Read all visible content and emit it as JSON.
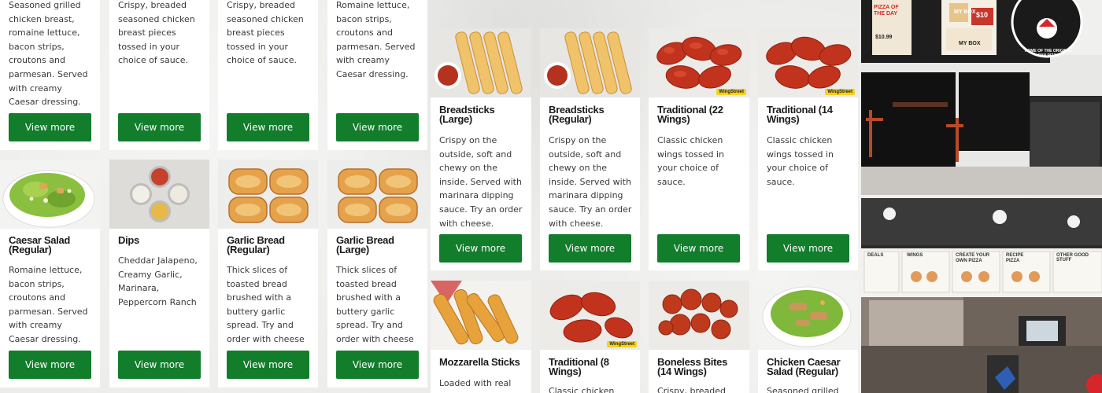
{
  "cards": [
    {
      "id": "chicken-caesar-top",
      "title": "",
      "desc": "Seasoned grilled chicken breast, romaine lettuce, bacon strips, croutons and parmesan. Served with creamy Caesar dressing.",
      "button": "View more"
    },
    {
      "id": "boneless-a-top",
      "title": "",
      "desc": "Crispy, breaded seasoned chicken breast pieces tossed in your choice of sauce.",
      "button": "View more"
    },
    {
      "id": "boneless-b-top",
      "title": "",
      "desc": "Crispy, breaded seasoned chicken breast pieces tossed in your choice of sauce.",
      "button": "View more"
    },
    {
      "id": "caesar-large-top",
      "title": "",
      "desc": "Romaine lettuce, bacon strips, croutons and parmesan. Served with creamy Caesar dressing.",
      "button": "View more"
    },
    {
      "id": "caesar-regular",
      "title": "Caesar Salad (Regular)",
      "desc": "Romaine lettuce, bacon strips, croutons and parmesan. Served with creamy Caesar dressing.",
      "button": "View more"
    },
    {
      "id": "dips",
      "title": "Dips",
      "desc": "Cheddar Jalapeno, Creamy Garlic, Marinara, Peppercorn Ranch",
      "button": "View more"
    },
    {
      "id": "garlic-bread-regular",
      "title": "Garlic Bread (Regular)",
      "desc": "Thick slices of toasted bread brushed with a buttery garlic spread. Try and order with cheese",
      "button": "View more"
    },
    {
      "id": "garlic-bread-large",
      "title": "Garlic Bread (Large)",
      "desc": "Thick slices of toasted bread brushed with a buttery garlic spread. Try and order with cheese",
      "button": "View more"
    },
    {
      "id": "breadsticks-large",
      "title": "Breadsticks (Large)",
      "desc": "Crispy on the outside, soft and chewy on the inside. Served with marinara dipping sauce. Try an order with cheese.",
      "button": "View more"
    },
    {
      "id": "breadsticks-regular",
      "title": "Breadsticks (Regular)",
      "desc": "Crispy on the outside, soft and chewy on the inside. Served with marinara dipping sauce. Try an order with cheese.",
      "button": "View more"
    },
    {
      "id": "traditional-22",
      "title": "Traditional (22 Wings)",
      "desc": "Classic chicken wings tossed in your choice of sauce.",
      "button": "View more",
      "badge": "WingStreet"
    },
    {
      "id": "traditional-14",
      "title": "Traditional (14 Wings)",
      "desc": "Classic chicken wings tossed in your choice of sauce.",
      "button": "View more",
      "badge": "WingStreet"
    },
    {
      "id": "mozzarella-sticks",
      "title": "Mozzarella Sticks",
      "desc": "Loaded with real",
      "button": ""
    },
    {
      "id": "traditional-8",
      "title": "Traditional (8 Wings)",
      "desc": "Classic chicken wings",
      "button": "",
      "badge": "WingStreet"
    },
    {
      "id": "boneless-14",
      "title": "Boneless Bites (14 Wings)",
      "desc": "Crispy, breaded",
      "button": ""
    },
    {
      "id": "chicken-caesar-regular",
      "title": "Chicken Caesar Salad (Regular)",
      "desc": "Seasoned grilled",
      "button": ""
    }
  ],
  "photos": {
    "storefront": {
      "pizza_of_the_day": "PIZZA OF THE DAY",
      "price_a": "$10.99",
      "my_box_a": "MY BOX",
      "my_box_b": "MY BOX",
      "my_box_price": "$10",
      "logo_text": "HOME OF THE ORIGINAL PAN PIZZA"
    },
    "menuboard": {
      "labels": [
        "DEALS",
        "WINGS",
        "CREATE YOUR OWN PIZZA",
        "RECIPE PIZZA",
        "OTHER GOOD STUFF"
      ]
    }
  },
  "colors": {
    "button_green": "#127d2b",
    "card_bg": "#ffffff"
  }
}
